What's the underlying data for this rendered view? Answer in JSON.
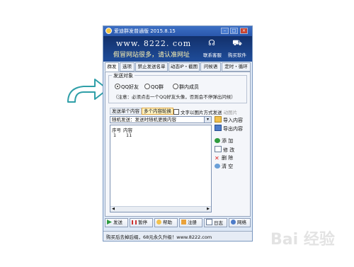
{
  "window": {
    "title": "爱迪群发普通版 2015.8.15",
    "controls": {
      "minimize": "–",
      "maximize": "□",
      "close": "×"
    }
  },
  "banner": {
    "site": "www. 8222. com",
    "slogan": "假冒网站很多，请认准网址",
    "contact_label": "联系客服",
    "buy_label": "购买软件",
    "icons": {
      "contact": "headset-icon",
      "buy": "cart-icon"
    }
  },
  "tabs": [
    {
      "label": "群发"
    },
    {
      "label": "选项"
    },
    {
      "label": "禁止发送名单"
    },
    {
      "label": "动态IP・截图"
    },
    {
      "label": "问候语"
    },
    {
      "label": "定时・循环"
    }
  ],
  "target_group": {
    "title": "发送对象",
    "options": [
      {
        "label": "QQ好友",
        "checked": true
      },
      {
        "label": "QQ群",
        "checked": false
      },
      {
        "label": "群内成员",
        "checked": false
      }
    ],
    "note": "（注意：必须点击一个QQ好友头像，否则会不停弹出问候）"
  },
  "content": {
    "tab_single": "发送单个内容",
    "tab_multi": "多个内容轮换",
    "checkbox_text": "文字以图片方式发送",
    "checkbox_disabled": "动图片",
    "dropdown_value": "随机发送：发送时随机更换内容",
    "dropdown_arrow": "▾",
    "table": {
      "columns": [
        "序号",
        "内容"
      ],
      "rows": [
        [
          "1",
          "11"
        ]
      ]
    },
    "side_buttons": {
      "import": "导入内容",
      "export": "导出内容",
      "add": "添 加",
      "edit": "修 改",
      "delete": "删 除",
      "clear": "清 空"
    }
  },
  "bottom_buttons": {
    "send": "发送",
    "pause": "暂停",
    "help": "帮助",
    "register": "注册",
    "log": "日志",
    "network": "网络"
  },
  "status": "购买后去掉后缀，68元永久升级！www.8222.com",
  "watermark": "Bai 经验",
  "colors": {
    "title": "#2a58ad",
    "banner": "#12306b",
    "accent": "#e0a640",
    "arrow": "#2f9fa8"
  }
}
